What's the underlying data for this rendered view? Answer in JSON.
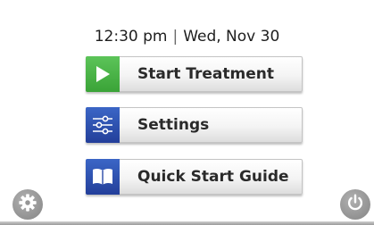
{
  "status": {
    "time": "12:30 pm",
    "separator": "|",
    "date": "Wed, Nov 30"
  },
  "menu": [
    {
      "label": "Start Treatment",
      "icon": "play-icon",
      "icon_color": "#4cb648"
    },
    {
      "label": "Settings",
      "icon": "sliders-icon",
      "icon_color": "#2f53b2"
    },
    {
      "label": "Quick Start Guide",
      "icon": "book-icon",
      "icon_color": "#2f53b2"
    }
  ],
  "footer": {
    "left_icon": "gear-icon",
    "right_icon": "power-icon"
  }
}
